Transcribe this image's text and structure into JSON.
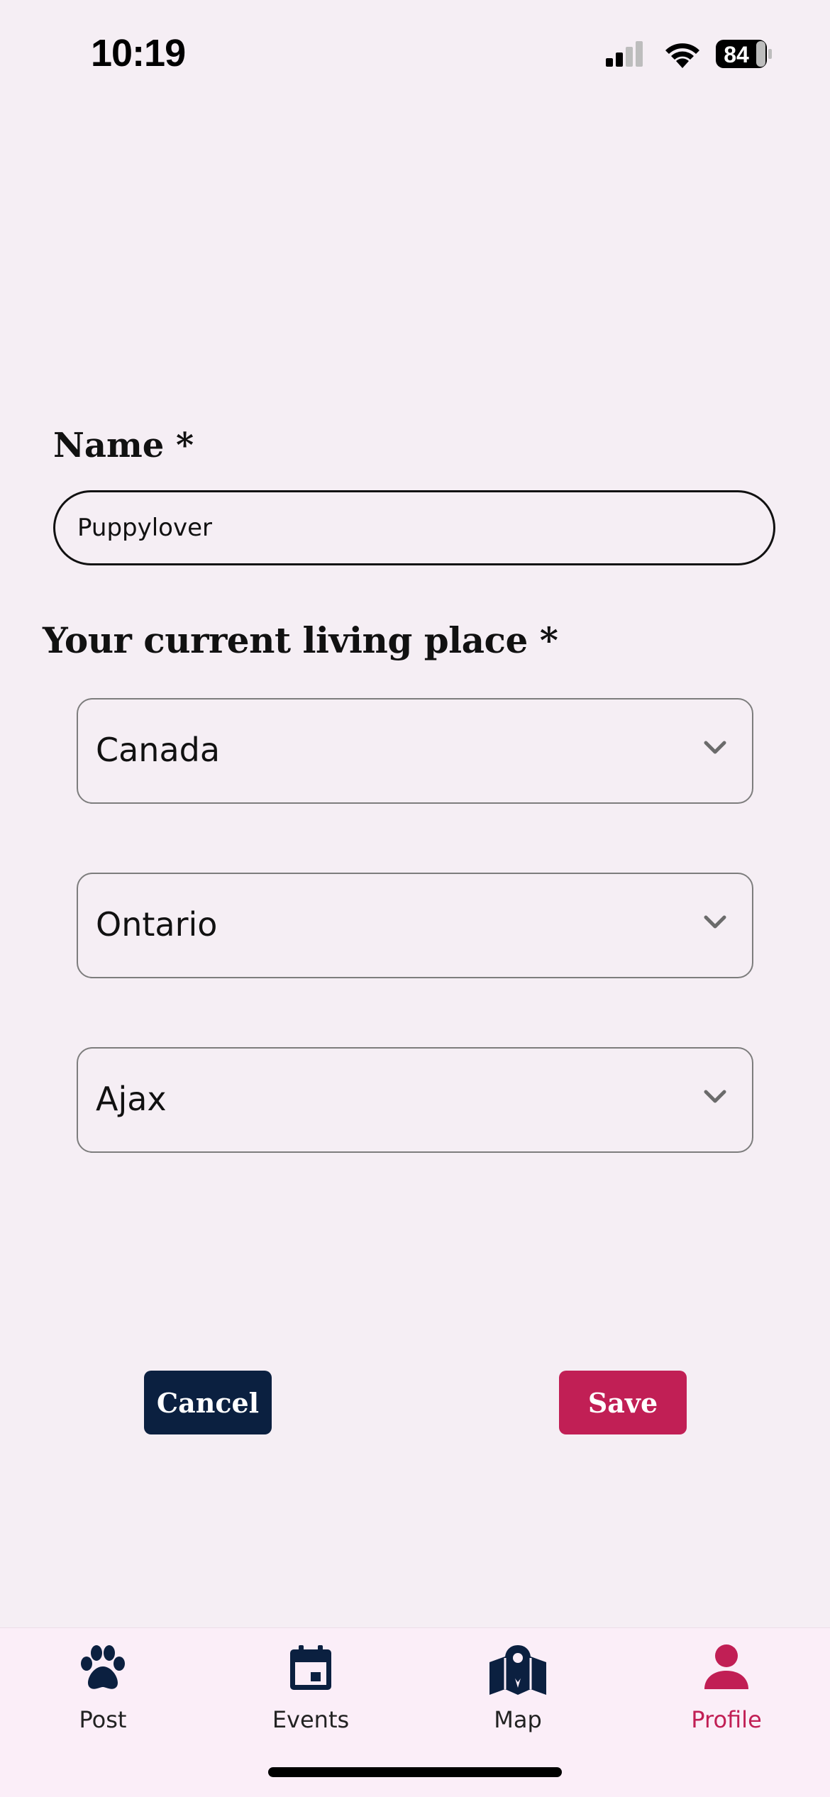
{
  "status_bar": {
    "time": "10:19",
    "battery": "84"
  },
  "form": {
    "name_label": "Name *",
    "name_value": "Puppylover",
    "place_label": "Your current living place *",
    "country": "Canada",
    "province": "Ontario",
    "city": "Ajax"
  },
  "buttons": {
    "cancel": "Cancel",
    "save": "Save"
  },
  "tabbar": {
    "tabs": [
      {
        "label": "Post",
        "icon": "paw-icon"
      },
      {
        "label": "Events",
        "icon": "calendar-icon"
      },
      {
        "label": "Map",
        "icon": "map-icon"
      },
      {
        "label": "Profile",
        "icon": "person-icon"
      }
    ],
    "active": "Profile"
  },
  "colors": {
    "background": "#f5eef4",
    "navy": "#0b2040",
    "accent": "#c11f55",
    "tabbar_bg": "#fbeef8"
  }
}
